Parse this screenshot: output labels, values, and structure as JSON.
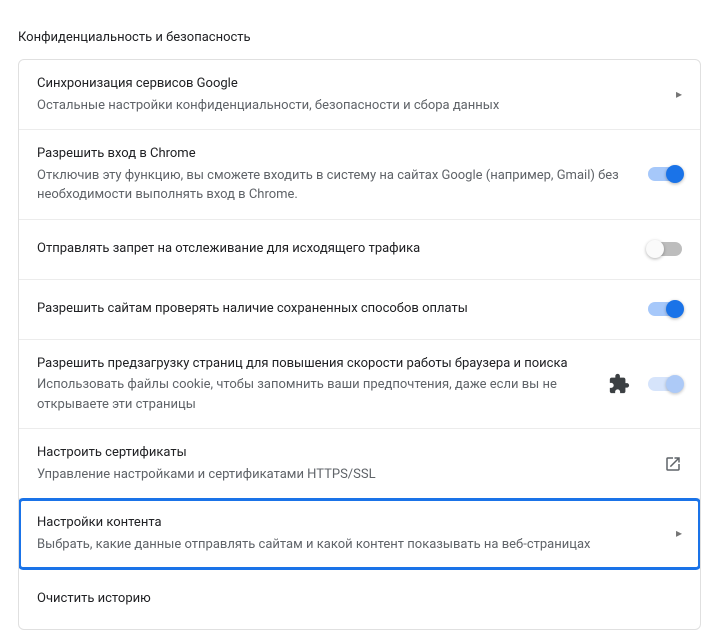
{
  "section_title": "Конфиденциальность и безопасность",
  "rows": {
    "sync_google": {
      "title": "Синхронизация сервисов Google",
      "desc": "Остальные настройки конфиденциальности, безопасности и сбора данных"
    },
    "allow_signin": {
      "title": "Разрешить вход в Chrome",
      "desc": "Отключив эту функцию, вы сможете входить в систему на сайтах Google (например, Gmail) без необходимости выполнять вход в Chrome."
    },
    "do_not_track": {
      "title": "Отправлять запрет на отслеживание для исходящего трафика"
    },
    "payment_methods": {
      "title": "Разрешить сайтам проверять наличие сохраненных способов оплаты"
    },
    "preload": {
      "title": "Разрешить предзагрузку страниц для повышения скорости работы браузера и поиска",
      "desc": "Использовать файлы cookie, чтобы запомнить ваши предпочтения, даже если вы не открываете эти страницы"
    },
    "certificates": {
      "title": "Настроить сертификаты",
      "desc": "Управление настройками и сертификатами HTTPS/SSL"
    },
    "content_settings": {
      "title": "Настройки контента",
      "desc": "Выбрать, какие данные отправлять сайтам и какой контент показывать на веб-страницах"
    },
    "clear_history": {
      "title": "Очистить историю"
    }
  }
}
